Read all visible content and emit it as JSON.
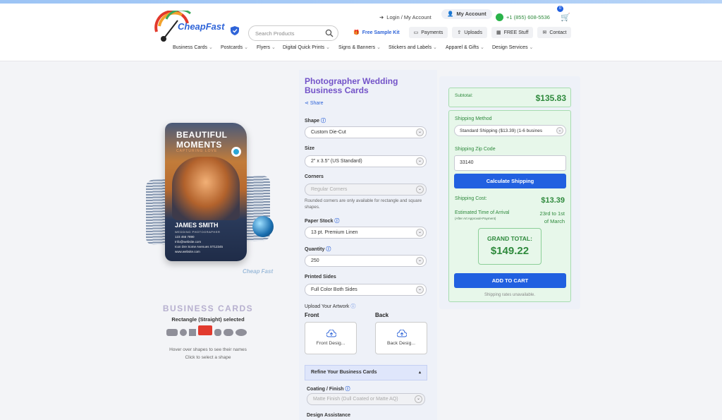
{
  "header": {
    "logo_text": "CheapFast",
    "search_placeholder": "Search Products",
    "login_label": "Login / My Account",
    "my_account_label": "My Account",
    "phone": "+1 (855) 608-5536",
    "cart_count": "0",
    "free_sample_kit": "Free Sample Kit",
    "payments": "Payments",
    "uploads": "Uploads",
    "free_stuff": "FREE Stuff",
    "contact": "Contact"
  },
  "nav": {
    "items": [
      "Business Cards",
      "Postcards",
      "Flyers",
      "Digital Quick Prints",
      "Signs & Banners",
      "Stickers and Labels",
      "Apparel & Gifts",
      "Design Services"
    ]
  },
  "product_image": {
    "headline": "BEAUTIFUL MOMENTS",
    "tagline": "CAPTURING LOVE",
    "name": "JAMES SMITH",
    "role": "WEDDING PHOTOGRAPHER",
    "contact_lines": [
      "123 456 7890",
      "Info@website.com",
      "Icon Dre Some Avenues ST12345",
      "www.website.com"
    ],
    "watermark": "Cheap Fast"
  },
  "shape_picker": {
    "title": "BUSINESS CARDS",
    "selected_text": "Rectangle (Straight) selected",
    "hint_line1": "Hover over shapes to see their names",
    "hint_line2": "Click to select a shape"
  },
  "product": {
    "title": "Photographer Wedding Business Cards",
    "share_label": "Share",
    "shape_label": "Shape",
    "shape_value": "Custom Die-Cut",
    "size_label": "Size",
    "size_value": "2\" x 3.5\" (US Standard)",
    "corners_label": "Corners",
    "corners_value": "Regular Corners",
    "corners_note": "Rounded corners are only available for rectangle and square shapes.",
    "paper_label": "Paper Stock",
    "paper_value": "13 pt. Premium Linen",
    "quantity_label": "Quantity",
    "quantity_value": "250",
    "sides_label": "Printed Sides",
    "sides_value": "Full Color Both Sides",
    "upload_label": "Upload Your Artwork",
    "front_heading": "Front",
    "back_heading": "Back",
    "front_btn": "Front Desig...",
    "back_btn": "Back Desig...",
    "refine_label": "Refine Your Business Cards",
    "coating_label": "Coating / Finish",
    "coating_value": "Matte Finish (Dull Coated or Matte AQ)",
    "design_assist_label": "Design Assistance"
  },
  "summary": {
    "subtotal_label": "Subtotal:",
    "subtotal_value": "$135.83",
    "shipping_method_label": "Shipping Method",
    "shipping_method_value": "Standard Shipping ($13.39) (1-6 busines",
    "zip_label": "Shipping Zip Code",
    "zip_value": "33140",
    "calc_btn": "Calculate Shipping",
    "ship_cost_label": "Shipping Cost:",
    "ship_cost_value": "$13.39",
    "eta_label": "Estimated Time of Arrival",
    "eta_sub": "(After Art Approval+Payment)",
    "eta_line1": "23rd to 1st",
    "eta_line2": "of March",
    "grand_total_label": "GRAND TOTAL:",
    "grand_total_value": "$149.22",
    "add_to_cart": "ADD TO CART",
    "unavailable_note": "Shipping rates unavailable."
  }
}
